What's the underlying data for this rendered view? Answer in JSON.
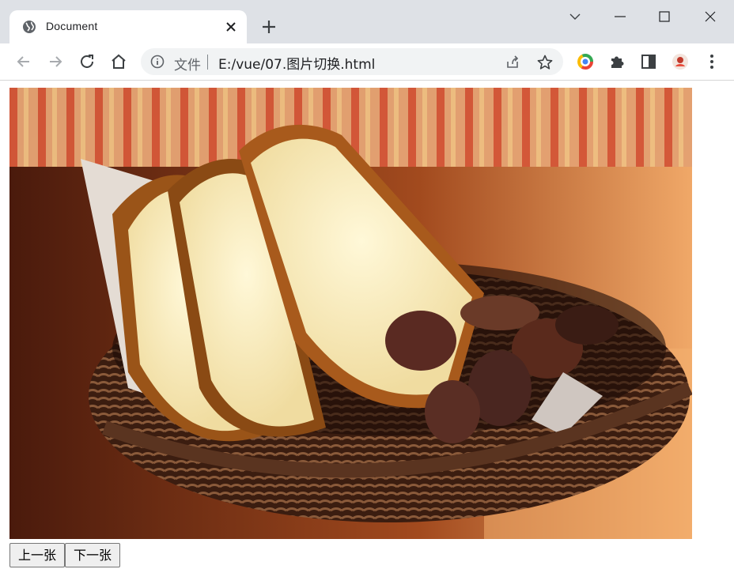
{
  "browser": {
    "tab": {
      "title": "Document",
      "icon": "globe-icon"
    },
    "omnibox": {
      "prefix": "文件",
      "url": "E:/vue/07.图片切换.html"
    },
    "colors": {
      "tabstrip": "#dee1e6",
      "omnibox": "#f1f3f4"
    }
  },
  "page": {
    "buttons": {
      "prev_label": "上一张",
      "next_label": "下一张"
    }
  }
}
